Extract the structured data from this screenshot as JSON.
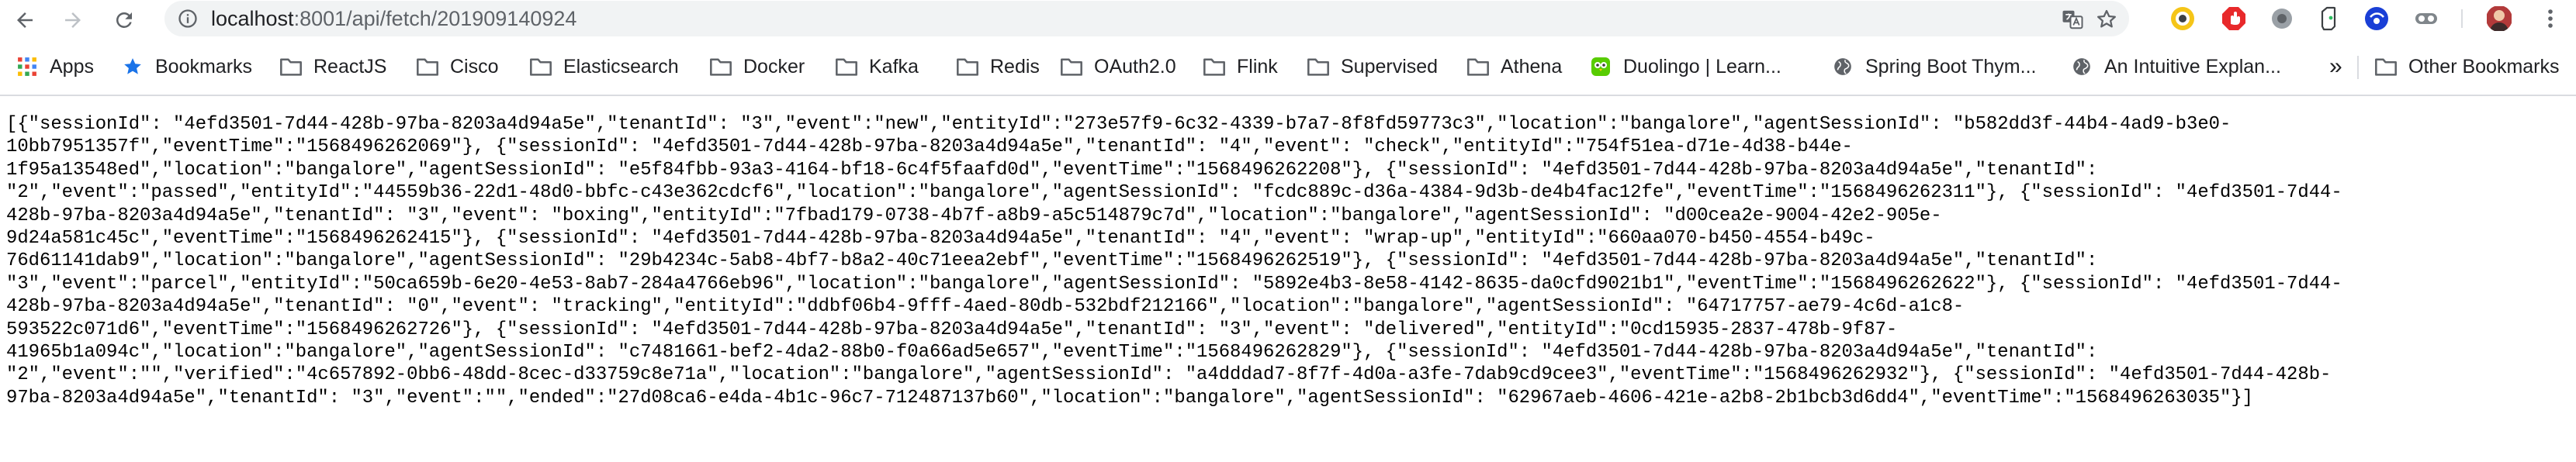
{
  "browser": {
    "url_host": "localhost",
    "url_path": ":8001/api/fetch/201909140924"
  },
  "bookmarks": [
    {
      "label": "Apps",
      "icon": "apps-grid-icon"
    },
    {
      "label": "Bookmarks",
      "icon": "star-icon"
    },
    {
      "label": "ReactJS",
      "icon": "folder-icon"
    },
    {
      "label": "Cisco",
      "icon": "folder-icon"
    },
    {
      "label": "Elasticsearch",
      "icon": "folder-icon"
    },
    {
      "label": "Docker",
      "icon": "folder-icon"
    },
    {
      "label": "Kafka",
      "icon": "folder-icon"
    },
    {
      "label": "Redis",
      "icon": "folder-icon"
    },
    {
      "label": "OAuth2.0",
      "icon": "folder-icon"
    },
    {
      "label": "Flink",
      "icon": "folder-icon"
    },
    {
      "label": "Supervised",
      "icon": "folder-icon"
    },
    {
      "label": "Athena",
      "icon": "folder-icon"
    },
    {
      "label": "Duolingo | Learn...",
      "icon": "duolingo-owl-icon"
    },
    {
      "label": "Spring Boot Thym...",
      "icon": "globe-icon"
    },
    {
      "label": "An Intuitive Explan...",
      "icon": "globe-icon"
    },
    {
      "label": "»",
      "icon": "chevron-double-right-icon"
    },
    {
      "label": "Other Bookmarks",
      "icon": "folder-icon"
    }
  ],
  "response_lines": [
    "[{\"sessionId\": \"4efd3501-7d44-428b-97ba-8203a4d94a5e\",\"tenantId\": \"3\",\"event\":\"new\",\"entityId\":\"273e57f9-6c32-4339-b7a7-8f8fd59773c3\",\"location\":\"bangalore\",\"agentSessionId\": \"b582dd3f-44b4-4ad9-b3e0-",
    "10bb7951357f\",\"eventTime\":\"1568496262069\"}, {\"sessionId\": \"4efd3501-7d44-428b-97ba-8203a4d94a5e\",\"tenantId\": \"4\",\"event\": \"check\",\"entityId\":\"754f51ea-d71e-4d38-b44e-",
    "1f95a13548ed\",\"location\":\"bangalore\",\"agentSessionId\": \"e5f84fbb-93a3-4164-bf18-6c4f5faafd0d\",\"eventTime\":\"1568496262208\"}, {\"sessionId\": \"4efd3501-7d44-428b-97ba-8203a4d94a5e\",\"tenantId\":",
    "\"2\",\"event\":\"passed\",\"entityId\":\"44559b36-22d1-48d0-bbfc-c43e362cdcf6\",\"location\":\"bangalore\",\"agentSessionId\": \"fcdc889c-d36a-4384-9d3b-de4b4fac12fe\",\"eventTime\":\"1568496262311\"}, {\"sessionId\": \"4efd3501-7d44-",
    "428b-97ba-8203a4d94a5e\",\"tenantId\": \"3\",\"event\": \"boxing\",\"entityId\":\"7fbad179-0738-4b7f-a8b9-a5c514879c7d\",\"location\":\"bangalore\",\"agentSessionId\": \"d00cea2e-9004-42e2-905e-",
    "9d24a581c45c\",\"eventTime\":\"1568496262415\"}, {\"sessionId\": \"4efd3501-7d44-428b-97ba-8203a4d94a5e\",\"tenantId\": \"4\",\"event\": \"wrap-up\",\"entityId\":\"660aa070-b450-4554-b49c-",
    "76d61141dab9\",\"location\":\"bangalore\",\"agentSessionId\": \"29b4234c-5ab8-4bf7-b8a2-40c71eea2ebf\",\"eventTime\":\"1568496262519\"}, {\"sessionId\": \"4efd3501-7d44-428b-97ba-8203a4d94a5e\",\"tenantId\":",
    "\"3\",\"event\":\"parcel\",\"entityId\":\"50ca659b-6e20-4e53-8ab7-284a4766eb96\",\"location\":\"bangalore\",\"agentSessionId\": \"5892e4b3-8e58-4142-8635-da0cfd9021b1\",\"eventTime\":\"1568496262622\"}, {\"sessionId\": \"4efd3501-7d44-",
    "428b-97ba-8203a4d94a5e\",\"tenantId\": \"0\",\"event\": \"tracking\",\"entityId\":\"ddbf06b4-9fff-4aed-80db-532bdf212166\",\"location\":\"bangalore\",\"agentSessionId\": \"64717757-ae79-4c6d-a1c8-",
    "593522c071d6\",\"eventTime\":\"1568496262726\"}, {\"sessionId\": \"4efd3501-7d44-428b-97ba-8203a4d94a5e\",\"tenantId\": \"3\",\"event\": \"delivered\",\"entityId\":\"0cd15935-2837-478b-9f87-",
    "41965b1a094c\",\"location\":\"bangalore\",\"agentSessionId\": \"c7481661-bef2-4da2-88b0-f0a66ad5e657\",\"eventTime\":\"1568496262829\"}, {\"sessionId\": \"4efd3501-7d44-428b-97ba-8203a4d94a5e\",\"tenantId\":",
    "\"2\",\"event\":\"\",\"verified\":\"4c657892-0bb6-48dd-8cec-d33759c8e71a\",\"location\":\"bangalore\",\"agentSessionId\": \"a4dddad7-8f7f-4d0a-a3fe-7dab9cd9cee3\",\"eventTime\":\"1568496262932\"}, {\"sessionId\": \"4efd3501-7d44-428b-",
    "97ba-8203a4d94a5e\",\"tenantId\": \"3\",\"event\":\"\",\"ended\":\"27d08ca6-e4da-4b1c-96c7-712487137b60\",\"location\":\"bangalore\",\"agentSessionId\": \"62967aeb-4606-421e-a2b8-2b1bcb3d6dd4\",\"eventTime\":\"1568496263035\"}]"
  ]
}
